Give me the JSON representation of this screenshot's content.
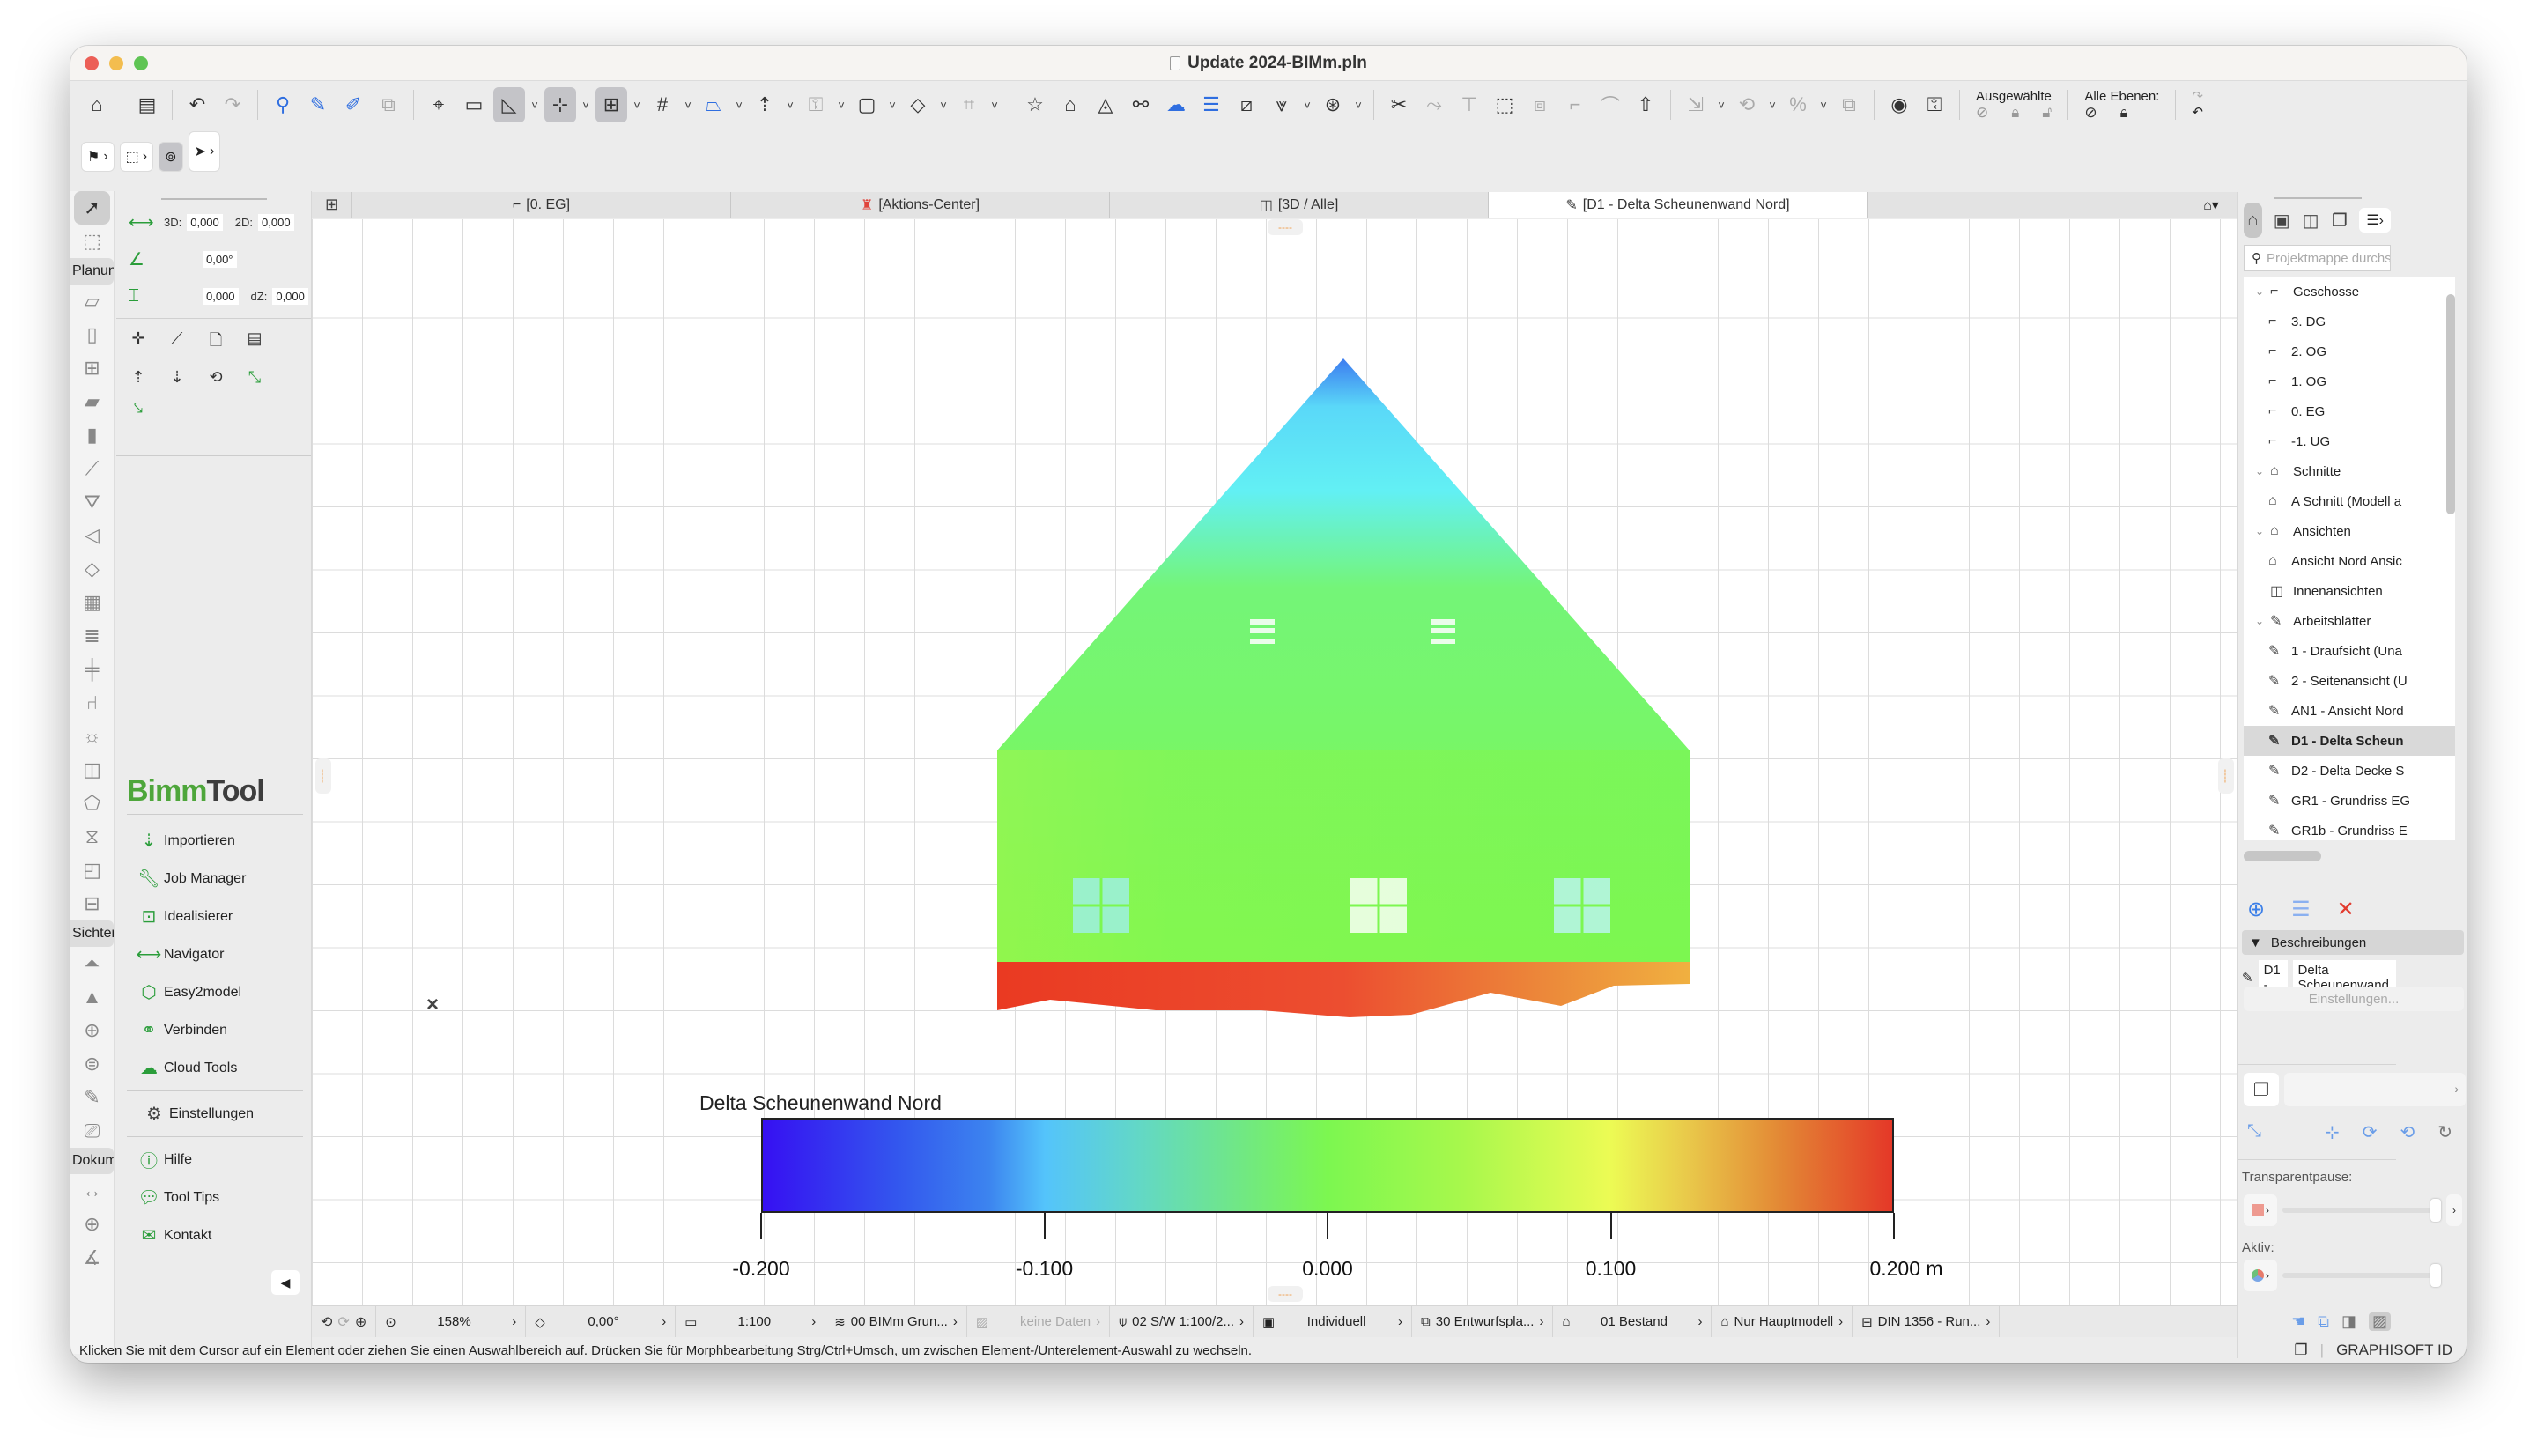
{
  "window": {
    "title": "Update 2024-BIMm.pln",
    "traffic_lights": [
      "close",
      "minimize",
      "zoom"
    ]
  },
  "toolbar": {
    "groups": [
      [
        "home-icon",
        "save-icon"
      ],
      [
        "undo-icon",
        "redo-icon"
      ],
      [
        "find-select-icon",
        "eyedropper-icon",
        "syringe-icon",
        "transfer-icon"
      ],
      [
        "snap-point-icon",
        "measure-icon",
        "guide-line-icon",
        "guide-icon",
        "coordinate-icon",
        "grid-snap-icon",
        "layout-icon",
        "elevation-icon",
        "lock-icon",
        "display-icon",
        "renovation-icon",
        "group-icon"
      ],
      [
        "favorite-icon",
        "model-view-icon",
        "section-icon",
        "link-icon",
        "cloud-icon",
        "property-icon",
        "attribute-icon",
        "filter-icon",
        "marker-icon"
      ],
      [
        "scissors-icon",
        "split-icon",
        "adjust-icon",
        "resize-icon",
        "fit-icon",
        "corner-icon",
        "fillet-icon",
        "roof-icon"
      ],
      [
        "offset-icon",
        "rotate-icon",
        "percent-icon",
        "copy-icon"
      ]
    ],
    "layers": {
      "show_hide_icon": "eye-swap-icon",
      "lock_icon": "lock-swap-icon",
      "selected_label": "Ausgewählte",
      "all_layers_label": "Alle Ebenen:"
    }
  },
  "toolbar2": {
    "items": [
      "selection-filter",
      "marquee-mode",
      "magic-wand",
      "arrow-tool"
    ]
  },
  "toolbox": {
    "sections": [
      {
        "label": "Planun"
      },
      {
        "label": "Sichter"
      },
      {
        "label": "Dokum"
      }
    ]
  },
  "info": {
    "row1": {
      "label3d": "3D:",
      "val3d": "0,000",
      "label2d": "2D:",
      "val2d": "0,000"
    },
    "row2": {
      "angle": "0,00°"
    },
    "row3": {
      "h": "0,000",
      "labeldz": "dZ:",
      "dz": "0,000"
    }
  },
  "bimmtool": {
    "logo_a": "Bimm",
    "logo_b": "Tool",
    "items": [
      {
        "label": "Importieren"
      },
      {
        "label": "Job Manager"
      },
      {
        "label": "Idealisierer"
      },
      {
        "label": "Navigator"
      },
      {
        "label": "Easy2model"
      },
      {
        "label": "Verbinden"
      },
      {
        "label": "Cloud Tools"
      }
    ],
    "settings": "Einstellungen",
    "help": [
      {
        "label": "Hilfe"
      },
      {
        "label": "Tool Tips"
      },
      {
        "label": "Kontakt"
      }
    ]
  },
  "tabs": [
    {
      "label": "[0. EG]",
      "active": false
    },
    {
      "label": "[Aktions-Center]",
      "active": false
    },
    {
      "label": "[3D / Alle]",
      "active": false
    },
    {
      "label": "[D1 - Delta Scheunenwand Nord]",
      "active": true
    }
  ],
  "canvas": {
    "legend": {
      "title": "Delta Scheunenwand Nord",
      "min": -0.2,
      "max": 0.2,
      "ticks": [
        "-0.200",
        "-0.100",
        "0.000",
        "0.100",
        "0.200 m"
      ],
      "tick_values": [
        -0.2,
        -0.1,
        0.0,
        0.1,
        0.2
      ],
      "colors": [
        "#3610f2",
        "#54c4fb",
        "#7cf750",
        "#ecfb54",
        "#e43828"
      ]
    }
  },
  "navigator": {
    "search_placeholder": "Projektmappe durchsuchen",
    "tree": [
      {
        "label": "Geschosse",
        "level": 0,
        "expanded": true,
        "icon": "story-icon"
      },
      {
        "label": "3. DG",
        "level": 1,
        "icon": "story-icon"
      },
      {
        "label": "2. OG",
        "level": 1,
        "icon": "story-icon"
      },
      {
        "label": "1. OG",
        "level": 1,
        "icon": "story-icon"
      },
      {
        "label": "0. EG",
        "level": 1,
        "icon": "story-icon"
      },
      {
        "label": "-1. UG",
        "level": 1,
        "icon": "story-icon"
      },
      {
        "label": "Schnitte",
        "level": 0,
        "expanded": true,
        "icon": "section-icon"
      },
      {
        "label": "A Schnitt (Modell a",
        "level": 1,
        "icon": "section-icon"
      },
      {
        "label": "Ansichten",
        "level": 0,
        "expanded": true,
        "icon": "elevation-icon"
      },
      {
        "label": "Ansicht Nord Ansic",
        "level": 1,
        "icon": "elevation-icon"
      },
      {
        "label": "Innenansichten",
        "level": 0,
        "expanded": false,
        "icon": "interior-elevation-icon"
      },
      {
        "label": "Arbeitsblätter",
        "level": 0,
        "expanded": true,
        "icon": "worksheet-icon"
      },
      {
        "label": "1 - Draufsicht (Una",
        "level": 1,
        "icon": "worksheet-icon"
      },
      {
        "label": "2 - Seitenansicht (U",
        "level": 1,
        "icon": "worksheet-icon"
      },
      {
        "label": "AN1 - Ansicht Nord",
        "level": 1,
        "icon": "worksheet-icon"
      },
      {
        "label": "D1 - Delta Scheun",
        "level": 1,
        "icon": "worksheet-icon",
        "selected": true
      },
      {
        "label": "D2 - Delta Decke S",
        "level": 1,
        "icon": "worksheet-icon"
      },
      {
        "label": "GR1 - Grundriss EG",
        "level": 1,
        "icon": "worksheet-icon"
      },
      {
        "label": "GR1b - Grundriss E",
        "level": 1,
        "icon": "worksheet-icon"
      }
    ],
    "descriptions_label": "Beschreibungen",
    "id_field": "D1 -",
    "name_field": "Delta Scheunenwand",
    "settings_button": "Einstellungen...",
    "transparency_label": "Transparentpause:",
    "active_label": "Aktiv:",
    "transparency_level": 1.0,
    "active_level": 1.0
  },
  "statusbar": {
    "zoom": "158%",
    "rotation": "0,00°",
    "scale": "1:100",
    "layer_combo": "00 BIMm Grun...",
    "no_data": "keine Daten",
    "pen_set": "02 S/W 1:100/2...",
    "model_view": "Individuell",
    "graphic_override": "30 Entwurfspla...",
    "renovation": "01 Bestand",
    "main_model": "Nur Hauptmodell",
    "dimension": "DIN 1356 - Run..."
  },
  "message": "Klicken Sie mit dem Cursor auf ein Element oder ziehen Sie einen Auswahlbereich auf. Drücken Sie für Morphbearbeitung Strg/Ctrl+Umsch, um zwischen Element-/Unterelement-Auswahl zu wechseln.",
  "brand": "GRAPHISOFT ID"
}
